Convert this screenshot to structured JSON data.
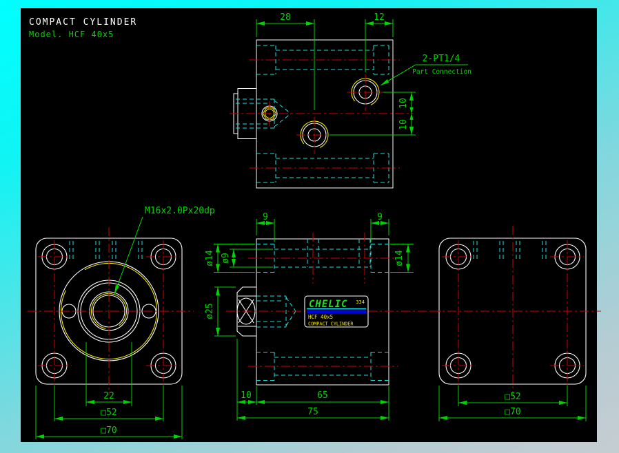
{
  "title": {
    "line1": "COMPACT CYLINDER",
    "line2": "Model. HCF 40x5"
  },
  "colors": {
    "object_line": "#ffffff",
    "dimension": "#00d400",
    "centerline": "#d40000",
    "hidden_line": "#22dede",
    "thread": "#f5e900",
    "canvas": "#000000",
    "nameplate_bar": "#0000dd"
  },
  "top_view": {
    "dim_port1_from_left": "28",
    "dim_port2_from_right": "12",
    "dim_port_offset_upper": "10",
    "dim_port_offset_lower": "10",
    "port_label": "2-PT1/4",
    "port_sublabel": "Part Connection"
  },
  "front_view": {
    "thread_label": "M16x2.0Px20dp",
    "dim_pilot": "22",
    "dim_bolt_square": "□52",
    "dim_body_square": "□70"
  },
  "side_view": {
    "dim_cbore_depth_left": "9",
    "dim_cbore_depth_right": "9",
    "dim_cbore_dia_left": "ø14",
    "dim_thru_dia": "ø9",
    "dim_boss_dia": "ø25",
    "dim_cbore_dia_right": "ø14",
    "dim_boss_len": "10",
    "dim_body_len": "65",
    "dim_total_len": "75",
    "nameplate": {
      "brand": "CHELIC",
      "code": "334",
      "model": "HCF 40x5",
      "product": "COMPACT CYLINDER"
    }
  },
  "rear_view": {
    "dim_bolt_square": "□52",
    "dim_body_square": "□70"
  }
}
